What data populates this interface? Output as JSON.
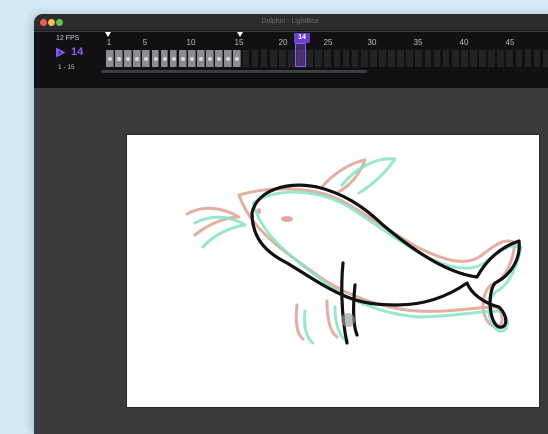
{
  "window": {
    "title": "Dolphin - LightBox"
  },
  "timeline": {
    "fps_label": "12 FPS",
    "current_frame": "14",
    "range_label": "1 - 15",
    "playhead_badge": "14",
    "ruler_ticks": [
      "1",
      "5",
      "10",
      "15",
      "20",
      "25",
      "30",
      "35",
      "40",
      "45"
    ],
    "filled_frames": 15,
    "total_cells": 55
  },
  "colors": {
    "accent": "#8b5cf6",
    "onion_prev": "#e0a090",
    "onion_next": "#86e3c6",
    "stroke": "#111111"
  }
}
